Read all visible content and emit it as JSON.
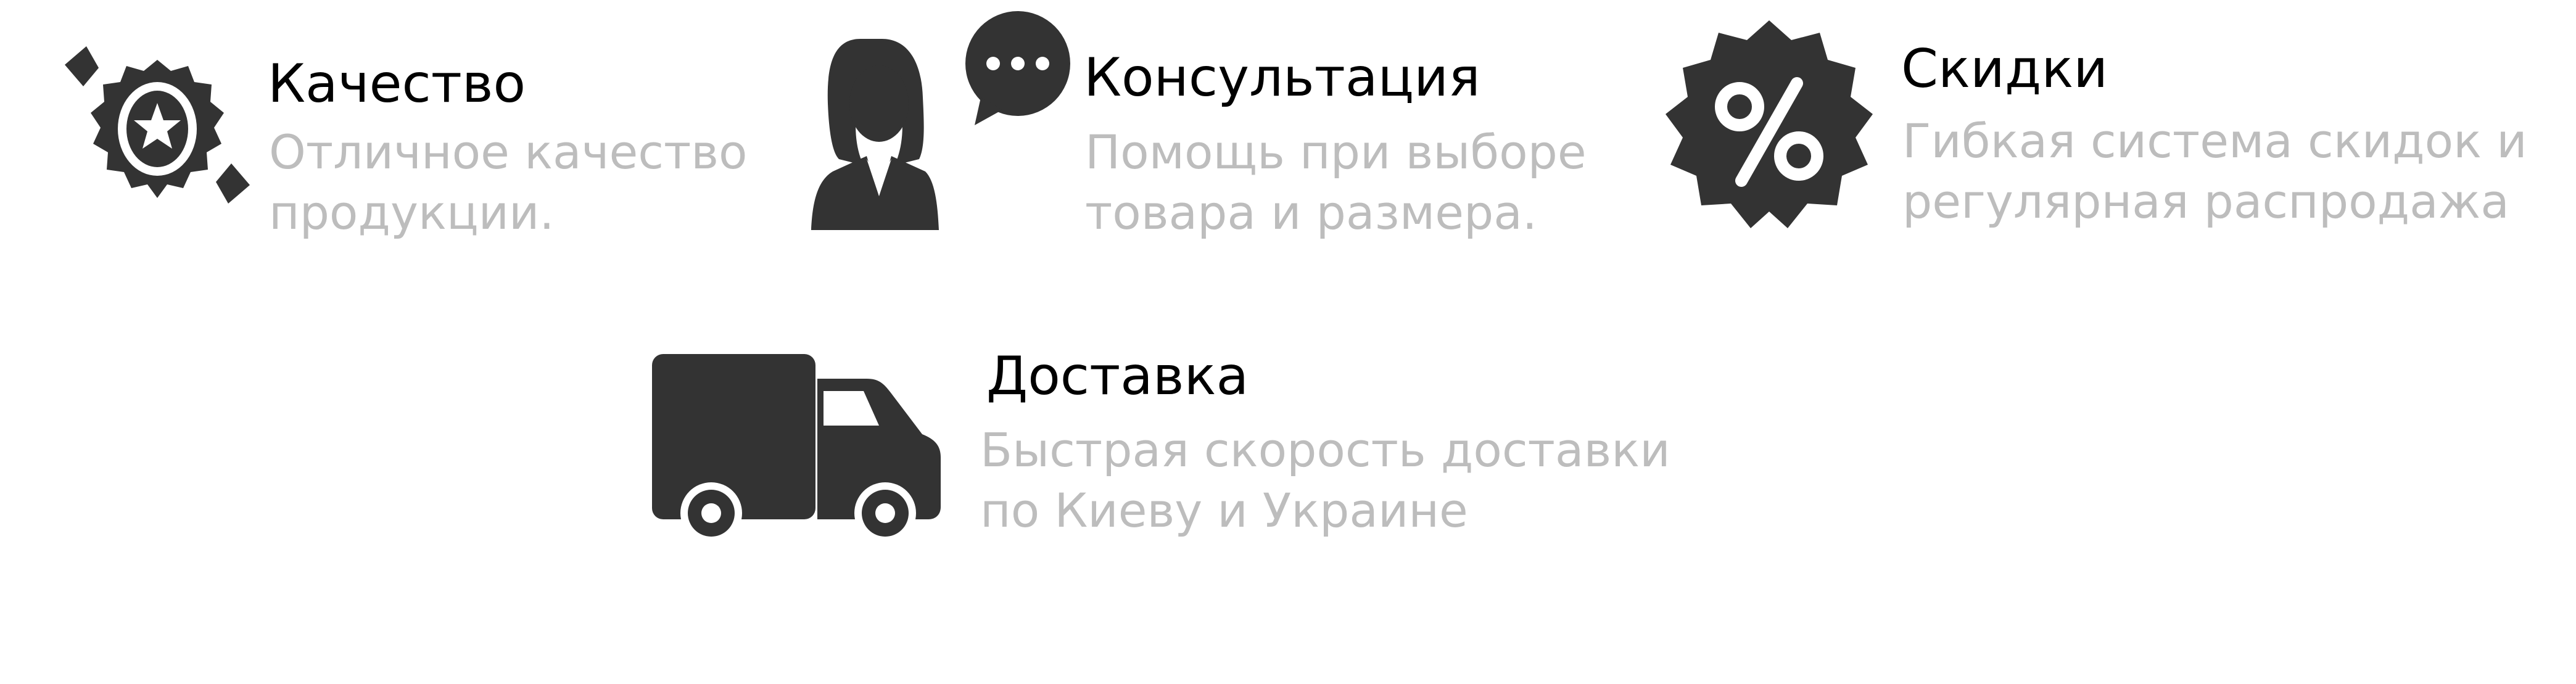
{
  "colors": {
    "icon": "#333333",
    "title": "#000000",
    "description": "#bdbdbd"
  },
  "features": [
    {
      "icon": "award-badge-icon",
      "title": "Качество",
      "lines": [
        "Отличное качество",
        "продукции."
      ]
    },
    {
      "icon": "consultant-chat-icon",
      "title": "Консультация",
      "lines": [
        "Помощь при выборе",
        "товара и размера."
      ]
    },
    {
      "icon": "discount-percent-icon",
      "title": "Скидки",
      "lines": [
        "Гибкая система скидок и",
        "регулярная распродажа"
      ]
    },
    {
      "icon": "delivery-truck-icon",
      "title": "Доставка",
      "lines": [
        "Быстрая скорость доставки",
        "по Киеву и Украине"
      ]
    }
  ]
}
